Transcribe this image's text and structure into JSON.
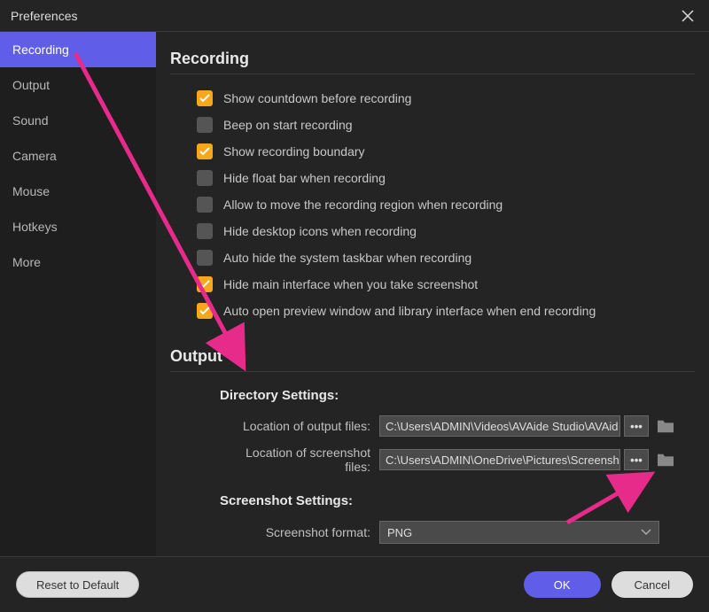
{
  "window": {
    "title": "Preferences"
  },
  "sidebar": {
    "items": [
      {
        "label": "Recording",
        "active": true
      },
      {
        "label": "Output",
        "active": false
      },
      {
        "label": "Sound",
        "active": false
      },
      {
        "label": "Camera",
        "active": false
      },
      {
        "label": "Mouse",
        "active": false
      },
      {
        "label": "Hotkeys",
        "active": false
      },
      {
        "label": "More",
        "active": false
      }
    ]
  },
  "recording": {
    "title": "Recording",
    "options": [
      {
        "label": "Show countdown before recording",
        "checked": true
      },
      {
        "label": "Beep on start recording",
        "checked": false
      },
      {
        "label": "Show recording boundary",
        "checked": true
      },
      {
        "label": "Hide float bar when recording",
        "checked": false
      },
      {
        "label": "Allow to move the recording region when recording",
        "checked": false
      },
      {
        "label": "Hide desktop icons when recording",
        "checked": false
      },
      {
        "label": "Auto hide the system taskbar when recording",
        "checked": false
      },
      {
        "label": "Hide main interface when you take screenshot",
        "checked": true
      },
      {
        "label": "Auto open preview window and library interface when end recording",
        "checked": true
      }
    ]
  },
  "output": {
    "title": "Output",
    "directory": {
      "title": "Directory Settings:",
      "output_label": "Location of output files:",
      "output_value": "C:\\Users\\ADMIN\\Videos\\AVAide Studio\\AVAid",
      "screenshot_label": "Location of screenshot files:",
      "screenshot_value": "C:\\Users\\ADMIN\\OneDrive\\Pictures\\Screensho",
      "browse_label": "•••"
    },
    "screenshot": {
      "title": "Screenshot Settings:",
      "format_label": "Screenshot format:",
      "format_value": "PNG"
    }
  },
  "footer": {
    "reset": "Reset to Default",
    "ok": "OK",
    "cancel": "Cancel"
  }
}
